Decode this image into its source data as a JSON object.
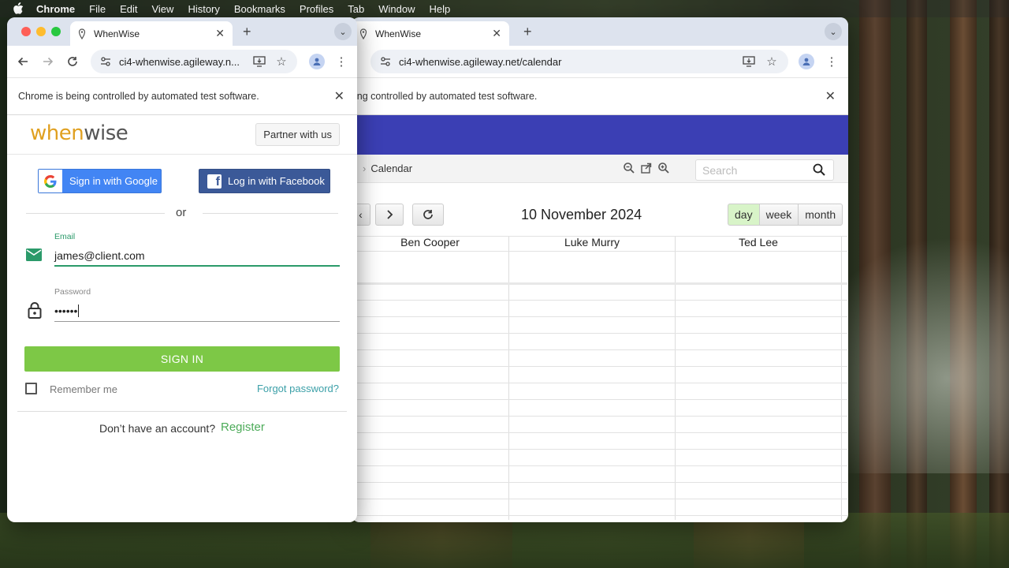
{
  "menubar": {
    "app": "Chrome",
    "items": [
      "File",
      "Edit",
      "View",
      "History",
      "Bookmarks",
      "Profiles",
      "Tab",
      "Window",
      "Help"
    ]
  },
  "right_window": {
    "tab_title": "WhenWise",
    "url": "ci4-whenwise.agileway.net/calendar",
    "infobar_text": "ing controlled by automated test software.",
    "breadcrumb": "Calendar",
    "search_placeholder": "Search",
    "calendar_title": "10 November 2024",
    "views": [
      "day",
      "week",
      "month"
    ],
    "active_view": "day",
    "columns": [
      "Ben Cooper",
      "Luke Murry",
      "Ted Lee"
    ],
    "header_color": "#3b3fb4"
  },
  "left_window": {
    "tab_title": "WhenWise",
    "url": "ci4-whenwise.agileway.n...",
    "infobar_text": "Chrome is being controlled by automated test software.",
    "logo": {
      "part1": "when",
      "part2": "wise"
    },
    "partner_button": "Partner with us",
    "google_button": "Sign in with Google",
    "facebook_button": "Log in with Facebook",
    "or": "or",
    "email_label": "Email",
    "email_value": "james@client.com",
    "password_label": "Password",
    "password_value": "••••••",
    "signin_button": "SIGN IN",
    "remember_me": "Remember me",
    "forgot_password": "Forgot password?",
    "no_account": "Don’t have an account?",
    "register": "Register",
    "accent_green": "#7dc846",
    "email_focus_color": "#2b9a6a"
  }
}
